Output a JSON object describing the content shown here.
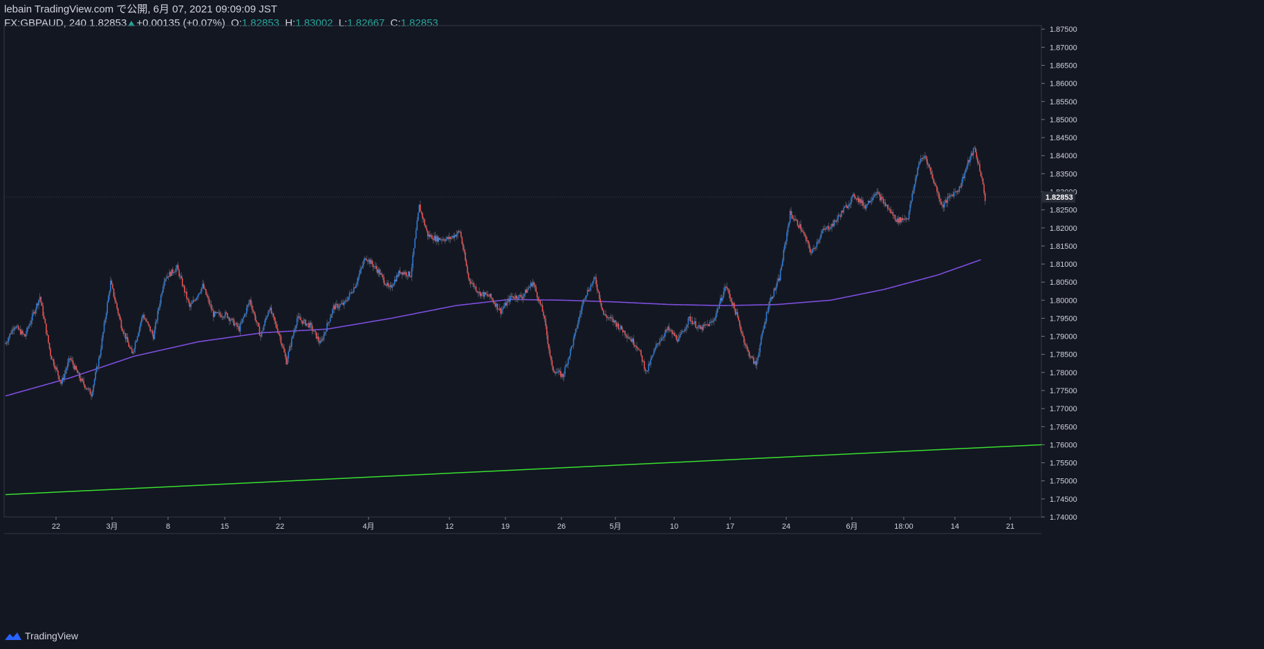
{
  "header": {
    "publish_line": "lebain TradingView.com で公開, 6月 07, 2021 09:09:09 JST",
    "symbol_interval": "FX:GBPAUD, 240",
    "last_price": "1.82853",
    "change": "+0.00135 (+0.07%)",
    "o_label": "O:",
    "o_value": "1.82853",
    "h_label": "H:",
    "h_value": "1.83002",
    "l_label": "L:",
    "l_value": "1.82667",
    "c_label": "C:",
    "c_value": "1.82853"
  },
  "footer": {
    "brand": "TradingView"
  },
  "colors": {
    "background": "#131722",
    "up": "#2c7ddb",
    "down": "#ef5350",
    "ma": "#7e4fe0",
    "trendline": "#39e32e",
    "axis_text": "#d1d4dc",
    "accent": "#26a69a"
  },
  "chart_data": {
    "type": "candlestick",
    "symbol": "FX:GBPAUD",
    "interval": "240",
    "ylim": [
      1.74,
      1.876
    ],
    "y_ticks": [
      "1.87500",
      "1.87000",
      "1.86500",
      "1.86000",
      "1.85500",
      "1.85000",
      "1.84500",
      "1.84000",
      "1.83500",
      "1.83000",
      "1.82500",
      "1.82000",
      "1.81500",
      "1.81000",
      "1.80500",
      "1.80000",
      "1.79500",
      "1.79000",
      "1.78500",
      "1.78000",
      "1.77500",
      "1.77000",
      "1.76500",
      "1.76000",
      "1.75500",
      "1.75000",
      "1.74500",
      "1.74000"
    ],
    "x_ticks": [
      "22",
      "3月",
      "8",
      "15",
      "22",
      "4月",
      "12",
      "19",
      "26",
      "5月",
      "10",
      "17",
      "24",
      "6月",
      "18:00",
      "14",
      "21"
    ],
    "current_price_label": "1.82853",
    "close_series": {
      "keypoints": [
        [
          0,
          1.788
        ],
        [
          8,
          1.793
        ],
        [
          18,
          1.79
        ],
        [
          32,
          1.801
        ],
        [
          42,
          1.785
        ],
        [
          52,
          1.777
        ],
        [
          60,
          1.784
        ],
        [
          70,
          1.778
        ],
        [
          80,
          1.774
        ],
        [
          88,
          1.785
        ],
        [
          98,
          1.805
        ],
        [
          108,
          1.793
        ],
        [
          118,
          1.785
        ],
        [
          128,
          1.796
        ],
        [
          138,
          1.79
        ],
        [
          148,
          1.806
        ],
        [
          160,
          1.809
        ],
        [
          172,
          1.798
        ],
        [
          184,
          1.804
        ],
        [
          194,
          1.796
        ],
        [
          206,
          1.796
        ],
        [
          218,
          1.792
        ],
        [
          228,
          1.8
        ],
        [
          238,
          1.79
        ],
        [
          246,
          1.798
        ],
        [
          256,
          1.79
        ],
        [
          262,
          1.783
        ],
        [
          272,
          1.795
        ],
        [
          284,
          1.793
        ],
        [
          294,
          1.788
        ],
        [
          306,
          1.798
        ],
        [
          316,
          1.799
        ],
        [
          326,
          1.804
        ],
        [
          336,
          1.812
        ],
        [
          348,
          1.808
        ],
        [
          358,
          1.803
        ],
        [
          368,
          1.808
        ],
        [
          378,
          1.807
        ],
        [
          386,
          1.826
        ],
        [
          394,
          1.818
        ],
        [
          402,
          1.817
        ],
        [
          414,
          1.817
        ],
        [
          424,
          1.819
        ],
        [
          432,
          1.806
        ],
        [
          442,
          1.802
        ],
        [
          452,
          1.801
        ],
        [
          462,
          1.797
        ],
        [
          472,
          1.801
        ],
        [
          482,
          1.801
        ],
        [
          492,
          1.805
        ],
        [
          502,
          1.796
        ],
        [
          510,
          1.781
        ],
        [
          520,
          1.779
        ],
        [
          530,
          1.789
        ],
        [
          540,
          1.801
        ],
        [
          550,
          1.806
        ],
        [
          558,
          1.796
        ],
        [
          568,
          1.794
        ],
        [
          578,
          1.791
        ],
        [
          590,
          1.787
        ],
        [
          598,
          1.78
        ],
        [
          608,
          1.788
        ],
        [
          618,
          1.792
        ],
        [
          628,
          1.789
        ],
        [
          638,
          1.795
        ],
        [
          648,
          1.792
        ],
        [
          660,
          1.794
        ],
        [
          672,
          1.804
        ],
        [
          682,
          1.796
        ],
        [
          692,
          1.786
        ],
        [
          700,
          1.782
        ],
        [
          712,
          1.799
        ],
        [
          722,
          1.806
        ],
        [
          732,
          1.824
        ],
        [
          742,
          1.82
        ],
        [
          752,
          1.813
        ],
        [
          762,
          1.819
        ],
        [
          772,
          1.821
        ],
        [
          782,
          1.825
        ],
        [
          792,
          1.829
        ],
        [
          802,
          1.826
        ],
        [
          812,
          1.83
        ],
        [
          822,
          1.826
        ],
        [
          832,
          1.822
        ],
        [
          842,
          1.823
        ],
        [
          852,
          1.838
        ],
        [
          858,
          1.84
        ],
        [
          866,
          1.833
        ],
        [
          874,
          1.826
        ],
        [
          882,
          1.829
        ],
        [
          890,
          1.831
        ],
        [
          898,
          1.838
        ],
        [
          904,
          1.842
        ],
        [
          910,
          1.835
        ],
        [
          914,
          1.828
        ]
      ]
    },
    "moving_average": [
      [
        0,
        1.7735
      ],
      [
        60,
        1.7785
      ],
      [
        120,
        1.7845
      ],
      [
        180,
        1.7885
      ],
      [
        240,
        1.791
      ],
      [
        300,
        1.792
      ],
      [
        360,
        1.795
      ],
      [
        420,
        1.7985
      ],
      [
        470,
        1.8002
      ],
      [
        520,
        1.8
      ],
      [
        570,
        1.7995
      ],
      [
        620,
        1.7988
      ],
      [
        670,
        1.7985
      ],
      [
        720,
        1.7988
      ],
      [
        770,
        1.8
      ],
      [
        820,
        1.803
      ],
      [
        870,
        1.807
      ],
      [
        910,
        1.8112
      ]
    ],
    "trendline": {
      "from": [
        0,
        1.7462
      ],
      "to": [
        1100,
        1.76
      ]
    }
  }
}
